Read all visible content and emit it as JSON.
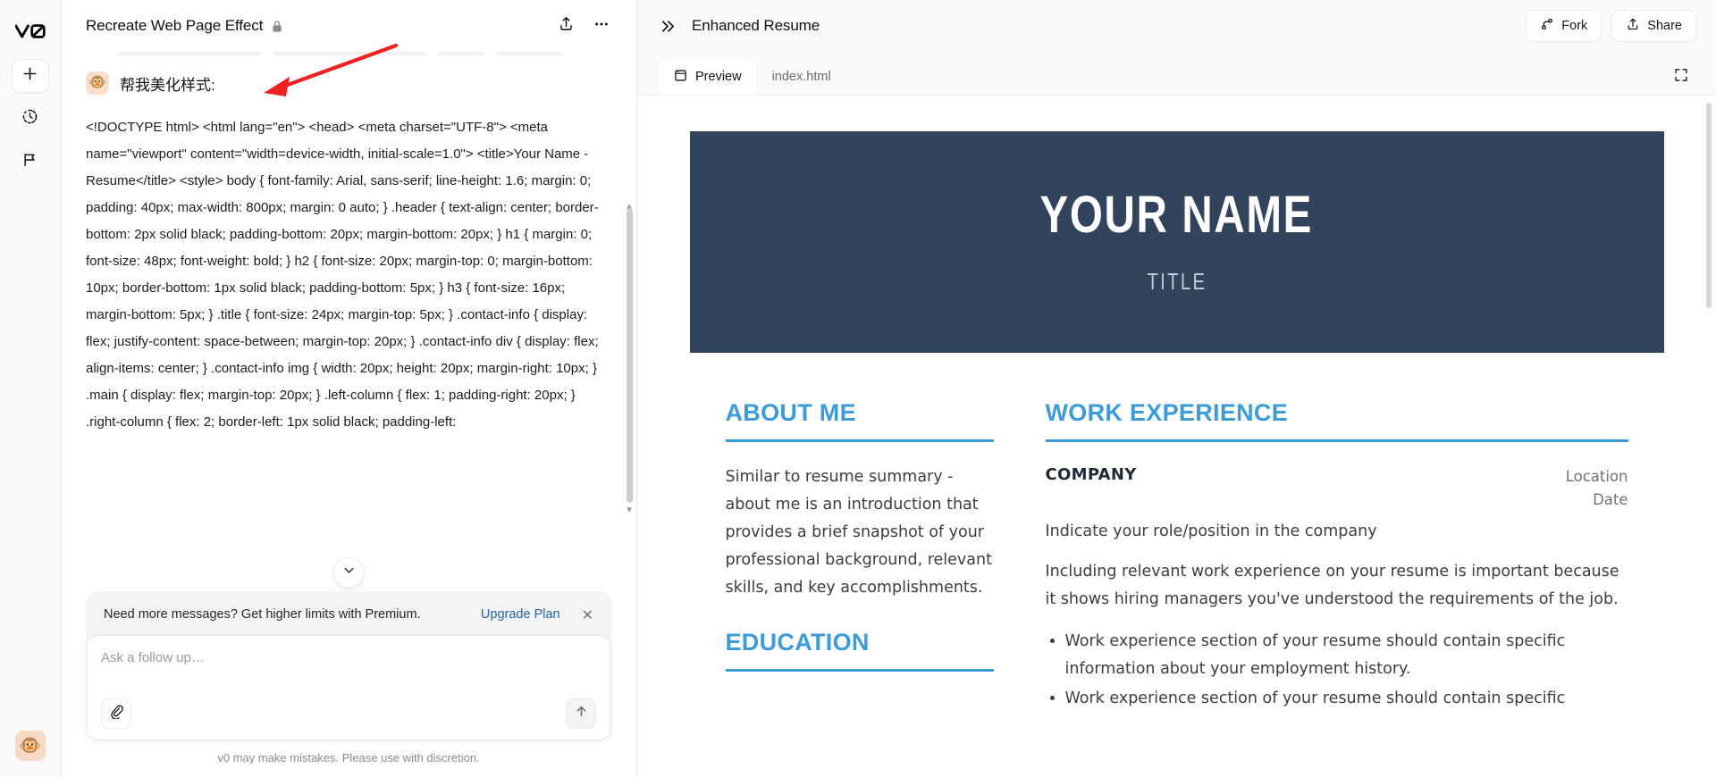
{
  "rail": {
    "logo_label": "v0-logo",
    "items": [
      {
        "name": "new-chat",
        "icon": "plus-icon",
        "label": "New chat"
      },
      {
        "name": "history",
        "icon": "clock-history-icon",
        "label": "History"
      },
      {
        "name": "feedback",
        "icon": "flag-icon",
        "label": "Feedback"
      }
    ],
    "avatar_emoji": "🐵"
  },
  "chat": {
    "title": "Recreate Web Page Effect",
    "lock_icon": "lock-icon",
    "share_icon": "share-icon",
    "more_icon": "more-horizontal-icon",
    "message": {
      "avatar_emoji": "🐵",
      "text": "帮我美化样式:",
      "code": "<!DOCTYPE html> <html lang=\"en\"> <head> <meta charset=\"UTF-8\"> <meta name=\"viewport\" content=\"width=device-width, initial-scale=1.0\"> <title>Your Name - Resume</title> <style> body { font-family: Arial, sans-serif; line-height: 1.6; margin: 0; padding: 40px; max-width: 800px; margin: 0 auto; } .header { text-align: center; border-bottom: 2px solid black; padding-bottom: 20px; margin-bottom: 20px; } h1 { margin: 0; font-size: 48px; font-weight: bold; } h2 { font-size: 20px; margin-top: 0; margin-bottom: 10px; border-bottom: 1px solid black; padding-bottom: 5px; } h3 { font-size: 16px; margin-bottom: 5px; } .title { font-size: 24px; margin-top: 5px; } .contact-info { display: flex; justify-content: space-between; margin-top: 20px; } .contact-info div { display: flex; align-items: center; } .contact-info img { width: 20px; height: 20px; margin-right: 10px; } .main { display: flex; margin-top: 20px; } .left-column { flex: 1; padding-right: 20px; } .right-column { flex: 2; border-left: 1px solid black; padding-left:"
    },
    "scroll_down_icon": "chevron-down-icon",
    "banner": {
      "text": "Need more messages? Get higher limits with Premium.",
      "link": "Upgrade Plan",
      "close_icon": "close-icon"
    },
    "composer": {
      "placeholder": "Ask a follow up…",
      "value": "",
      "attach_icon": "paperclip-icon",
      "send_icon": "arrow-up-icon"
    },
    "disclaimer": "v0 may make mistakes. Please use with discretion."
  },
  "preview": {
    "collapse_icon": "chevrons-right-icon",
    "title": "Enhanced Resume",
    "fork_label": "Fork",
    "fork_icon": "git-fork-icon",
    "share_label": "Share",
    "share_icon": "share-icon",
    "tabs": [
      {
        "label": "Preview",
        "icon": "browser-window-icon",
        "active": true
      },
      {
        "label": "index.html",
        "icon": "",
        "active": false
      }
    ],
    "expand_icon": "maximize-icon"
  },
  "resume": {
    "colors": {
      "hero_bg": "#31445c",
      "accent": "#3b9cd9",
      "body_text": "#3d3d3d"
    },
    "name": "YOUR NAME",
    "role": "TITLE",
    "left": {
      "about": {
        "heading": "ABOUT ME",
        "body": "Similar to resume summary - about me is an introduction that provides a brief snapshot of your professional background, relevant skills, and key accomplishments."
      },
      "education": {
        "heading": "EDUCATION"
      }
    },
    "right": {
      "work": {
        "heading": "WORK EXPERIENCE",
        "company": "COMPANY",
        "location": "Location",
        "date": "Date",
        "role_line": "Indicate your role/position in the company",
        "description": "Including relevant work experience on your resume is important because it shows hiring managers you've understood the requirements of the job.",
        "bullets": [
          "Work experience section of your resume should contain specific information about your employment history.",
          "Work experience section of your resume should contain specific"
        ]
      }
    }
  }
}
